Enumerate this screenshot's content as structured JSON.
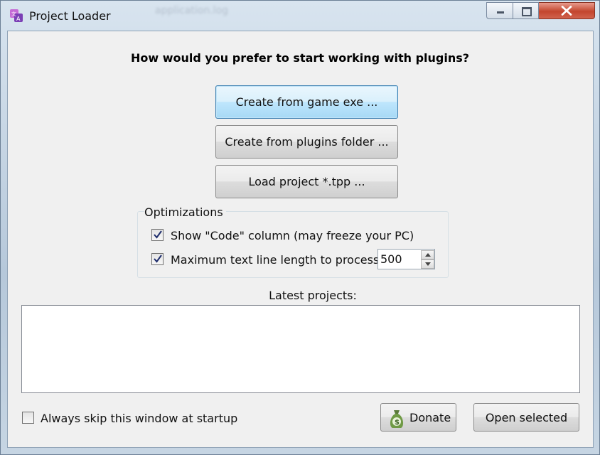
{
  "window": {
    "title": "Project Loader",
    "background_text": [
      "application.log"
    ]
  },
  "main": {
    "question": "How would you prefer to start working with plugins?",
    "buttons": {
      "create_from_exe": "Create from game exe ...",
      "create_from_folder": "Create from plugins folder ...",
      "load_project": "Load project *.tpp ..."
    }
  },
  "optimizations": {
    "group_label": "Optimizations",
    "show_code_label": "Show \"Code\" column (may freeze your PC)",
    "show_code_checked": true,
    "max_length_label": "Maximum text line length to process:",
    "max_length_checked": true,
    "max_length_value": "500"
  },
  "latest": {
    "label": "Latest projects:",
    "items": []
  },
  "footer": {
    "skip_label": "Always skip this window at startup",
    "skip_checked": false,
    "donate_label": "Donate",
    "open_selected_label": "Open selected"
  },
  "icons": {
    "app": "app-icon",
    "minimize": "minimize-icon",
    "maximize": "maximize-icon",
    "close": "close-icon",
    "checkmark": "checkmark-icon",
    "spin_up": "spin-up-icon",
    "spin_down": "spin-down-icon",
    "donate": "money-bag-icon"
  },
  "colors": {
    "close_button": "#c3452e",
    "focused_button_border": "#3c7fb1",
    "client_bg": "#f0f0f0"
  }
}
